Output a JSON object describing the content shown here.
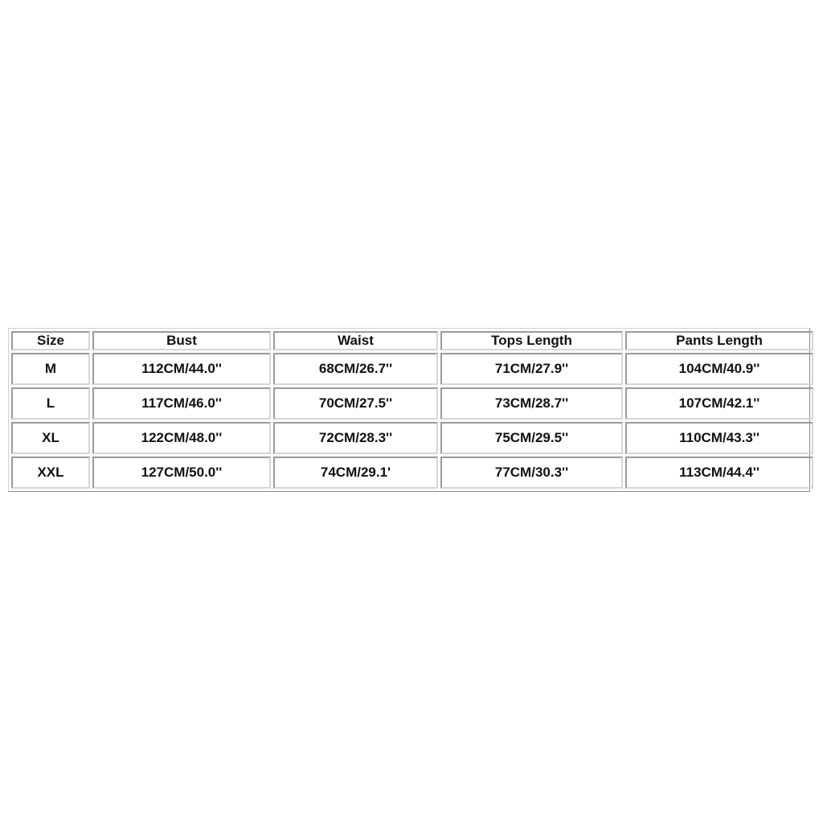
{
  "table": {
    "headers": [
      "Size",
      "Bust",
      "Waist",
      "Tops Length",
      "Pants Length"
    ],
    "rows": [
      [
        "M",
        "112CM/44.0''",
        "68CM/26.7''",
        "71CM/27.9''",
        "104CM/40.9''"
      ],
      [
        "L",
        "117CM/46.0''",
        "70CM/27.5''",
        "73CM/28.7''",
        "107CM/42.1''"
      ],
      [
        "XL",
        "122CM/48.0''",
        "72CM/28.3''",
        "75CM/29.5''",
        "110CM/43.3''"
      ],
      [
        "XXL",
        "127CM/50.0''",
        "74CM/29.1'",
        "77CM/30.3''",
        "113CM/44.4''"
      ]
    ]
  }
}
